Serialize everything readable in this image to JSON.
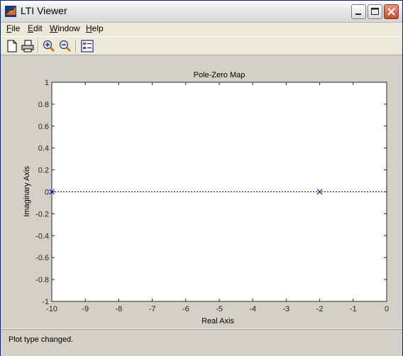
{
  "window": {
    "title": "LTI Viewer"
  },
  "menu": [
    {
      "id": "file",
      "label": "File",
      "mnemonic": "F",
      "rest": "ile"
    },
    {
      "id": "edit",
      "label": "Edit",
      "mnemonic": "E",
      "rest": "dit"
    },
    {
      "id": "window",
      "label": "Window",
      "mnemonic": "W",
      "rest": "indow"
    },
    {
      "id": "help",
      "label": "Help",
      "mnemonic": "H",
      "rest": "elp"
    }
  ],
  "toolbar": {
    "buttons": [
      "new-document-icon",
      "print-icon",
      "zoom-in-icon",
      "zoom-out-icon",
      "legend-icon"
    ]
  },
  "status": {
    "text": "Plot type changed."
  },
  "colors": {
    "marker": "#0000ff",
    "axis": "#262626"
  },
  "chart_data": {
    "type": "scatter",
    "title": "Pole-Zero Map",
    "xlabel": "Real Axis",
    "ylabel": "Imaginary Axis",
    "xlim": [
      -10,
      0
    ],
    "ylim": [
      -1,
      1
    ],
    "xticks": [
      -10,
      -9,
      -8,
      -7,
      -6,
      -5,
      -4,
      -3,
      -2,
      -1,
      0
    ],
    "yticks": [
      -1,
      -0.8,
      -0.6,
      -0.4,
      -0.2,
      0,
      0.2,
      0.4,
      0.6,
      0.8,
      1
    ],
    "grid": false,
    "series": [
      {
        "marker": "x",
        "points": [
          {
            "x": -10,
            "y": 0
          },
          {
            "x": -2,
            "y": 0
          }
        ]
      }
    ]
  }
}
